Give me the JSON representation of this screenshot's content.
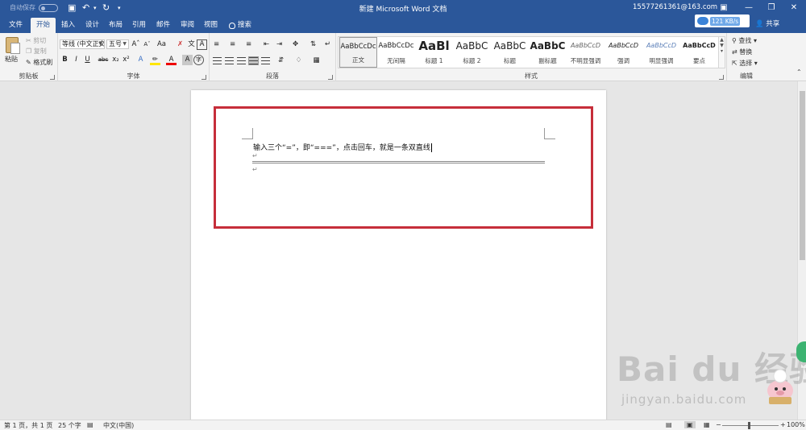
{
  "titlebar": {
    "autosave_label": "自动保存",
    "autosave_state": "关",
    "doc_title": "新建 Microsoft Word 文档",
    "account": "15577261361@163.com",
    "buttons": [
      "ribbon-display-icon",
      "minimize-icon",
      "restore-icon",
      "close-icon"
    ]
  },
  "tabs": [
    {
      "label": "文件"
    },
    {
      "label": "开始"
    },
    {
      "label": "插入"
    },
    {
      "label": "设计"
    },
    {
      "label": "布局"
    },
    {
      "label": "引用"
    },
    {
      "label": "邮件"
    },
    {
      "label": "审阅"
    },
    {
      "label": "视图"
    },
    {
      "label": "搜索"
    }
  ],
  "active_tab": "开始",
  "net_speed": "121 KB/s",
  "share_label": "共享",
  "ribbon": {
    "clipboard": {
      "label": "剪贴板",
      "paste": "粘贴",
      "cut": "剪切",
      "copy": "复制",
      "format_painter": "格式刷"
    },
    "font": {
      "label": "字体",
      "font_name": "等线 (中文正文)",
      "font_size": "五号"
    },
    "paragraph": {
      "label": "段落"
    },
    "styles": {
      "label": "样式",
      "items": [
        {
          "sample": "AaBbCcDc",
          "name": "正文"
        },
        {
          "sample": "AaBbCcDc",
          "name": "无间隔"
        },
        {
          "sample": "AaBl",
          "name": "标题 1"
        },
        {
          "sample": "AaBbC",
          "name": "标题 2"
        },
        {
          "sample": "AaBbC",
          "name": "标题"
        },
        {
          "sample": "AaBbC",
          "name": "副标题"
        },
        {
          "sample": "AaBbCcD",
          "name": "不明显强调"
        },
        {
          "sample": "AaBbCcD",
          "name": "强调"
        },
        {
          "sample": "AaBbCcD",
          "name": "明显强调"
        },
        {
          "sample": "AaBbCcD",
          "name": "要点"
        }
      ]
    },
    "editing": {
      "label": "编辑",
      "find": "查找",
      "replace": "替换",
      "select": "选择"
    }
  },
  "document": {
    "text": "输入三个“=”，即“===”，点击回车，就是一条双直线"
  },
  "watermark": {
    "logo": "Bai du 经验",
    "url": "jingyan.baidu.com"
  },
  "statusbar": {
    "page": "第 1 页，共 1 页",
    "words": "25 个字",
    "language": "中文(中国)",
    "zoom": "100%"
  },
  "colors": {
    "accent": "#2b579a",
    "highlight_box": "#c62e3a"
  }
}
